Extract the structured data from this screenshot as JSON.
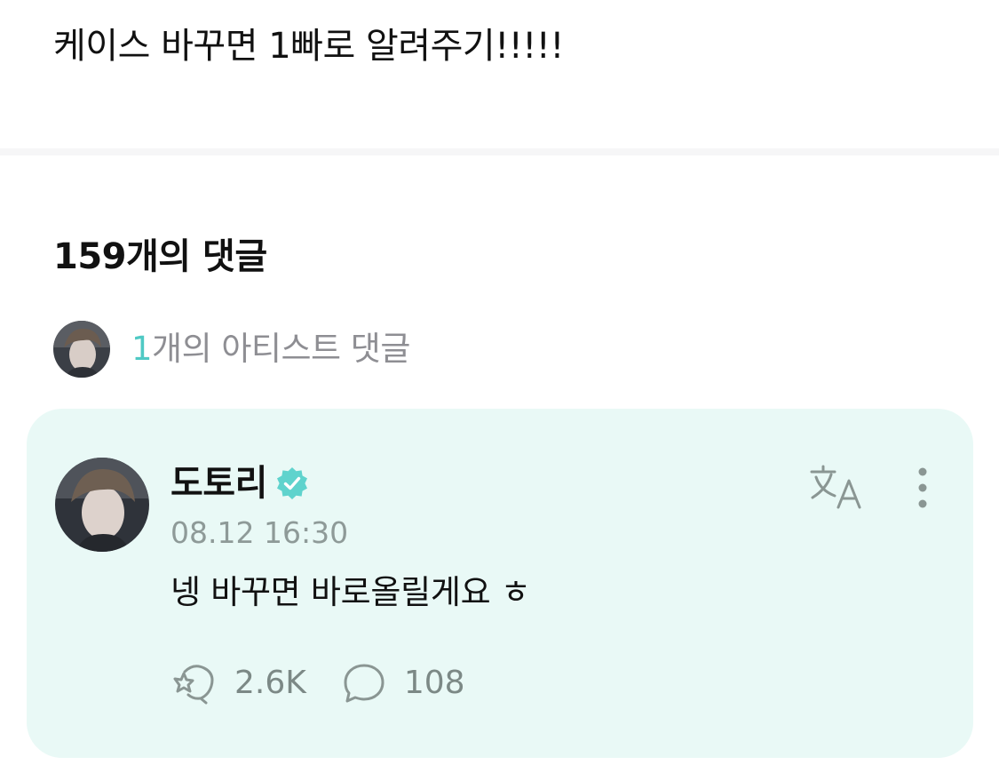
{
  "post": {
    "text": "케이스 바꾸면 1빠로 알려주기!!!!!"
  },
  "comments": {
    "total_label": "159개의 댓글",
    "artist_summary": {
      "count": "1",
      "suffix": "개의 아티스트 댓글",
      "avatar_icon": "artist-avatar-thumbnail"
    }
  },
  "comment": {
    "author": "도토리",
    "verified_icon": "verified-badge-icon",
    "timestamp": "08.12 16:30",
    "body": "넹 바꾸면 바로올릴게요 ㅎ",
    "likes": "2.6K",
    "replies": "108",
    "icons": {
      "translate": "translate-icon",
      "more": "more-vertical-icon",
      "like": "sparkle-heart-icon",
      "reply": "speech-bubble-icon"
    }
  },
  "colors": {
    "accent": "#4fc9c4",
    "card_background": "#e9f9f6",
    "muted_text": "#8e8e93",
    "icon_gray": "#8a9693"
  }
}
